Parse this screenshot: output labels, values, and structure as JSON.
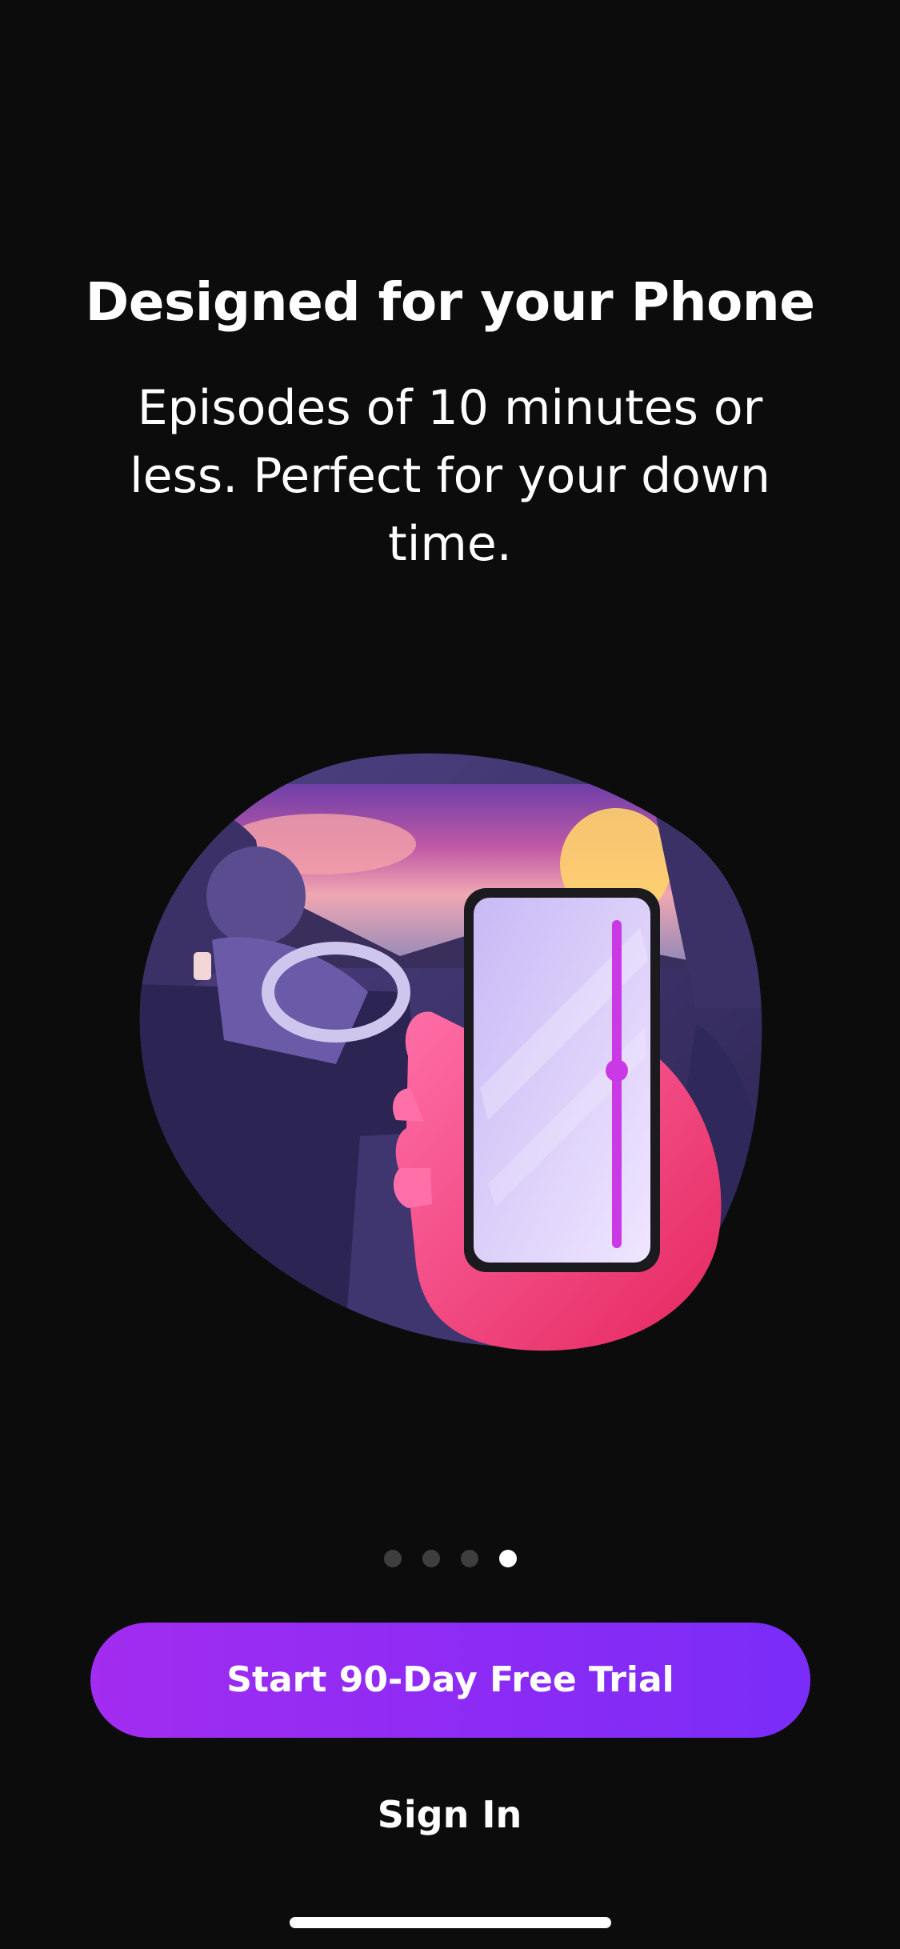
{
  "onboarding": {
    "title": "Designed for your Phone",
    "subtitle": "Episodes of 10 minutes or less. Perfect for your down time.",
    "illustration": "hand-holding-phone-in-car",
    "page_indicator": {
      "total": 4,
      "current": 4
    }
  },
  "actions": {
    "primary_label": "Start 90-Day Free Trial",
    "secondary_label": "Sign In"
  },
  "colors": {
    "background": "#0c0c0c",
    "primary_start": "#a22cf0",
    "primary_end": "#7a2cf8",
    "text": "#ffffff"
  }
}
